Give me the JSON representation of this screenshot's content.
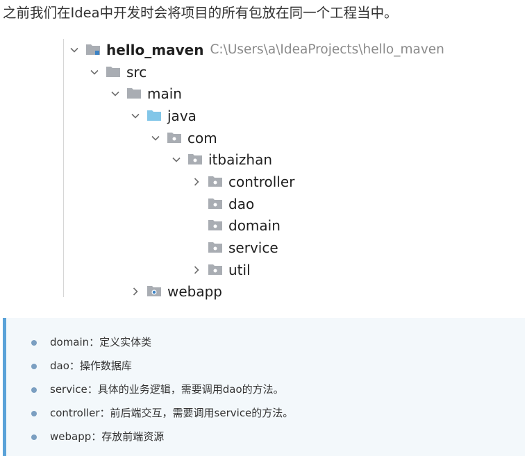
{
  "intro_text": "之前我们在Idea中开发时会将项目的所有包放在同一个工程当中。",
  "tree": {
    "root": {
      "label": "hello_maven",
      "path": "C:\\Users\\a\\IdeaProjects\\hello_maven"
    },
    "nodes": [
      {
        "label": "src",
        "expanded": true,
        "icon": "folder-icon"
      },
      {
        "label": "main",
        "expanded": true,
        "icon": "folder-icon"
      },
      {
        "label": "java",
        "expanded": true,
        "icon": "source-folder-icon"
      },
      {
        "label": "com",
        "expanded": true,
        "icon": "package-icon"
      },
      {
        "label": "itbaizhan",
        "expanded": true,
        "icon": "package-icon"
      },
      {
        "label": "controller",
        "expanded": false,
        "icon": "package-icon"
      },
      {
        "label": "dao",
        "icon": "package-icon"
      },
      {
        "label": "domain",
        "icon": "package-icon"
      },
      {
        "label": "service",
        "icon": "package-icon"
      },
      {
        "label": "util",
        "expanded": false,
        "icon": "package-icon"
      },
      {
        "label": "webapp",
        "expanded": false,
        "icon": "web-folder-icon"
      }
    ]
  },
  "notes": [
    "domain：定义实体类",
    "dao：操作数据库",
    "service：具体的业务逻辑，需要调用dao的方法。",
    "controller：前后端交互，需要调用service的方法。",
    "webapp：存放前端资源"
  ],
  "colors": {
    "folder": "#a9adb3",
    "source_folder": "#82c6e8",
    "note_border": "#5aa2d8",
    "note_bg": "#f3f8fb",
    "bullet": "#7b9fc1"
  }
}
